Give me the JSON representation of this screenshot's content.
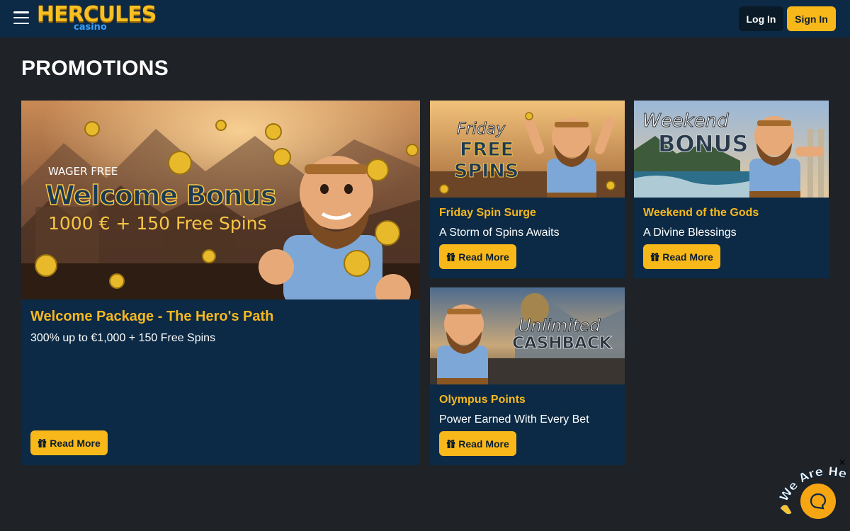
{
  "header": {
    "logo_main": "HERCULES",
    "logo_sub": "casino",
    "login_label": "Log In",
    "signin_label": "Sign In"
  },
  "page_title": "PROMOTIONS",
  "promotions": [
    {
      "image_text": [
        "WAGER FREE",
        "Welcome Bonus",
        "1000 € + 150 Free Spins"
      ],
      "title": "Welcome Package - The Hero's Path",
      "subtitle": "300% up to €1,000 + 150 Free Spins",
      "button_label": "Read More"
    },
    {
      "image_text": [
        "Friday",
        "FREE",
        "SPINS"
      ],
      "title": "Friday Spin Surge",
      "subtitle": "A Storm of Spins Awaits",
      "button_label": "Read More"
    },
    {
      "image_text": [
        "Weekend",
        "BONUS"
      ],
      "title": "Weekend of the Gods",
      "subtitle": "A Divine Blessings",
      "button_label": "Read More"
    },
    {
      "image_text": [
        "Unlimited",
        "CASHBACK"
      ],
      "title": "Olympus Points",
      "subtitle": "Power Earned With Every Bet",
      "button_label": "Read More"
    }
  ],
  "chat_widget": {
    "tagline": "We Are Here!",
    "close_symbol": "×"
  },
  "colors": {
    "header_bg": "#0c2a45",
    "page_bg": "#1f2227",
    "accent": "#f8b81a",
    "title_gold": "#f7b81f"
  },
  "icons": [
    "hamburger-menu-icon",
    "gift-icon",
    "chat-bubble-icon",
    "close-icon",
    "waving-hand-icon"
  ]
}
